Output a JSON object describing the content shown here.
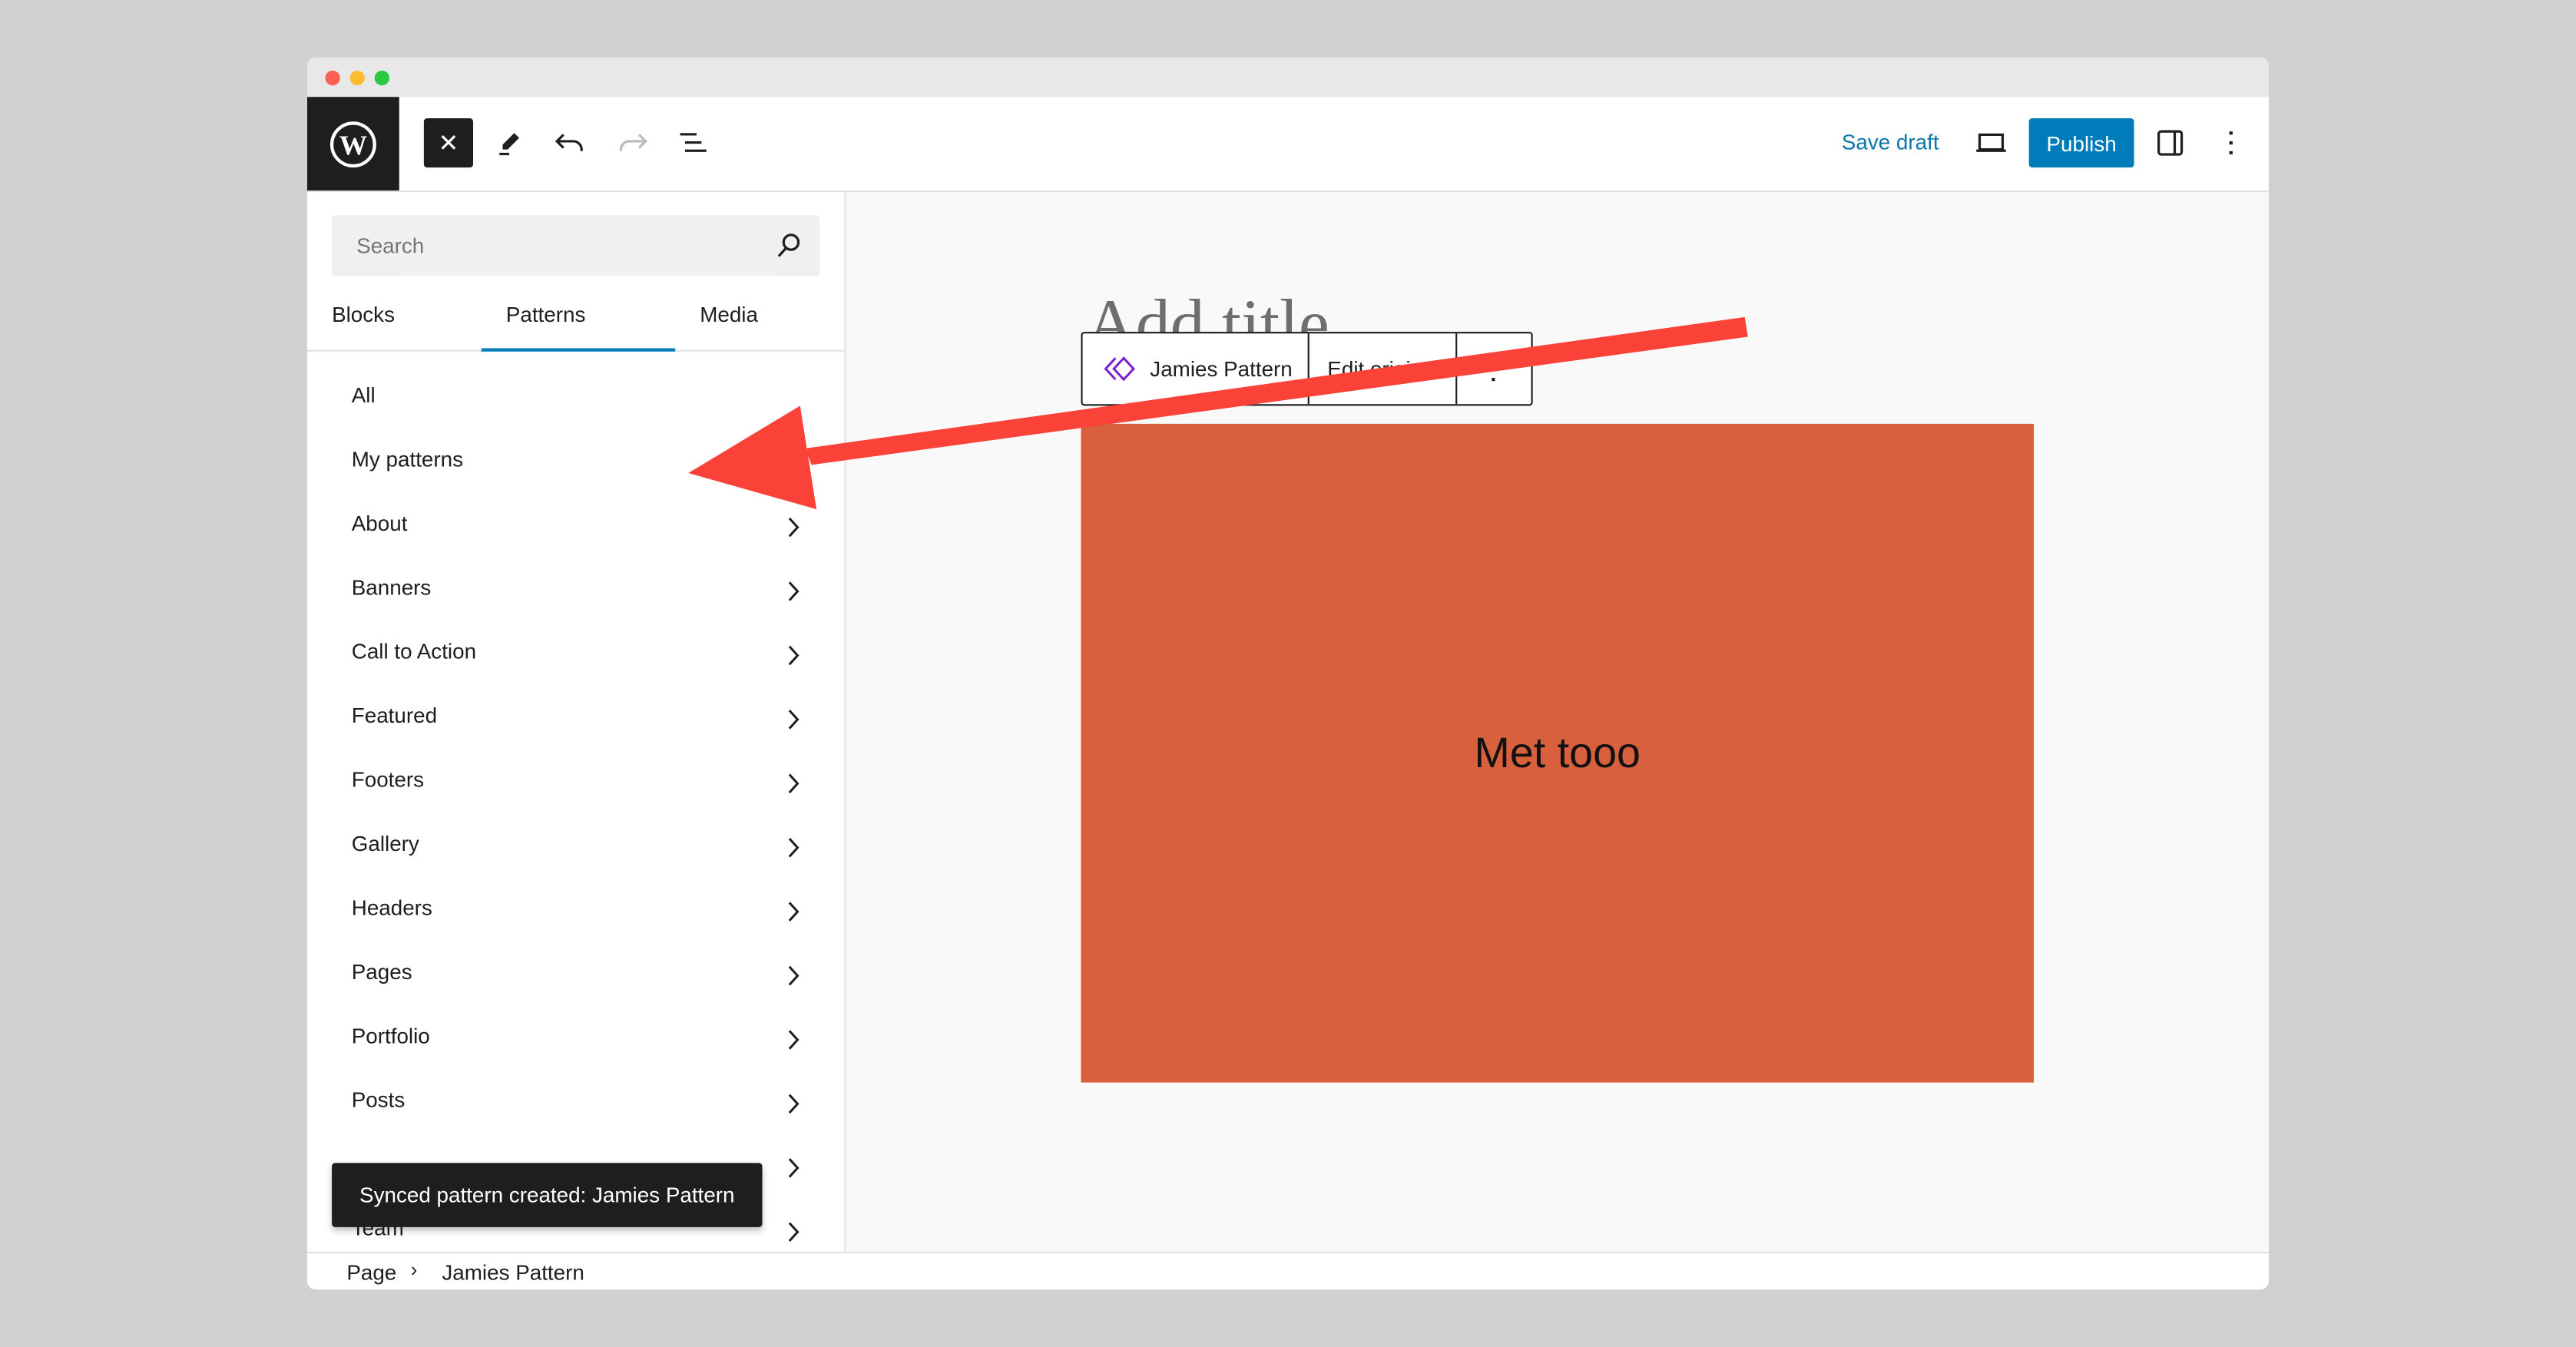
{
  "window": {
    "controls": [
      "close",
      "minimize",
      "maximize"
    ]
  },
  "header": {
    "save_draft": "Save draft",
    "publish": "Publish",
    "icons": [
      "wordpress-logo",
      "close-icon",
      "pencil-icon",
      "undo-icon",
      "redo-icon",
      "list-view-icon",
      "desktop-preview-icon",
      "sidebar-toggle-icon",
      "more-options-icon"
    ]
  },
  "sidebar": {
    "search_placeholder": "Search",
    "tabs": [
      {
        "label": "Blocks"
      },
      {
        "label": "Patterns",
        "active": true
      },
      {
        "label": "Media"
      }
    ],
    "items": [
      "All",
      "My patterns",
      "About",
      "Banners",
      "Call to Action",
      "Featured",
      "Footers",
      "Gallery",
      "Headers",
      "Pages",
      "Portfolio",
      "Posts",
      "",
      "Team"
    ]
  },
  "toast": {
    "message": "Synced pattern created: Jamies Pattern"
  },
  "footer": {
    "breadcrumb": [
      "Page",
      "Jamies Pattern"
    ]
  },
  "canvas": {
    "title_placeholder": "Add title",
    "block_toolbar": {
      "pattern_name": "Jamies Pattern",
      "edit_label": "Edit original"
    },
    "block_text": "Met tooo",
    "block_color": "#d9603d"
  },
  "colors": {
    "accent": "#007cba",
    "annotation_arrow": "#fa4238",
    "pattern_icon": "#7a1fd6"
  }
}
